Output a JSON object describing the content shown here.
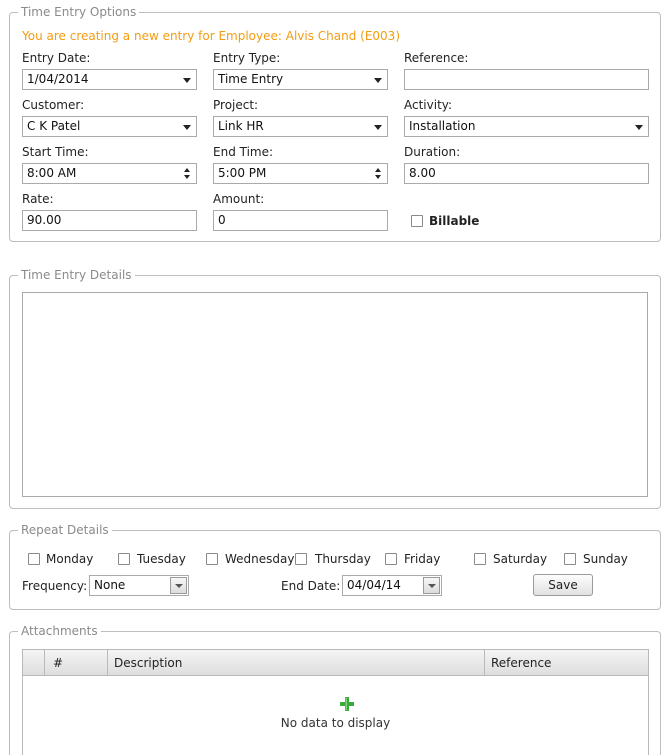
{
  "time_entry_options": {
    "legend": "Time Entry Options",
    "notice": "You are creating a new entry for Employee: Alvis Chand (E003)",
    "entry_date": {
      "label": "Entry Date:",
      "value": "1/04/2014"
    },
    "entry_type": {
      "label": "Entry Type:",
      "value": "Time Entry"
    },
    "reference": {
      "label": "Reference:",
      "value": ""
    },
    "customer": {
      "label": "Customer:",
      "value": "C K Patel"
    },
    "project": {
      "label": "Project:",
      "value": "Link HR"
    },
    "activity": {
      "label": "Activity:",
      "value": "Installation"
    },
    "start_time": {
      "label": "Start Time:",
      "value": "8:00 AM"
    },
    "end_time": {
      "label": "End Time:",
      "value": "5:00 PM"
    },
    "duration": {
      "label": "Duration:",
      "value": "8.00"
    },
    "rate": {
      "label": "Rate:",
      "value": "90.00"
    },
    "amount": {
      "label": "Amount:",
      "value": "0"
    },
    "billable": {
      "label": "Billable",
      "checked": false
    }
  },
  "time_entry_details": {
    "legend": "Time Entry Details",
    "text": ""
  },
  "repeat_details": {
    "legend": "Repeat Details",
    "days": [
      {
        "label": "Monday",
        "checked": false
      },
      {
        "label": "Tuesday",
        "checked": false
      },
      {
        "label": "Wednesday",
        "checked": false
      },
      {
        "label": "Thursday",
        "checked": false
      },
      {
        "label": "Friday",
        "checked": false
      },
      {
        "label": "Saturday",
        "checked": false
      },
      {
        "label": "Sunday",
        "checked": false
      }
    ],
    "frequency": {
      "label": "Frequency:",
      "value": "None"
    },
    "end_date": {
      "label": "End Date:",
      "value": "04/04/14"
    },
    "save_label": "Save"
  },
  "attachments": {
    "legend": "Attachments",
    "columns": [
      "#",
      "Description",
      "Reference"
    ],
    "empty_text": "No data to display",
    "add_color": "#3aa93a"
  },
  "colors": {
    "notice": "#f39c12",
    "legend": "#8a8a8a",
    "border": "#bdbdbd"
  }
}
